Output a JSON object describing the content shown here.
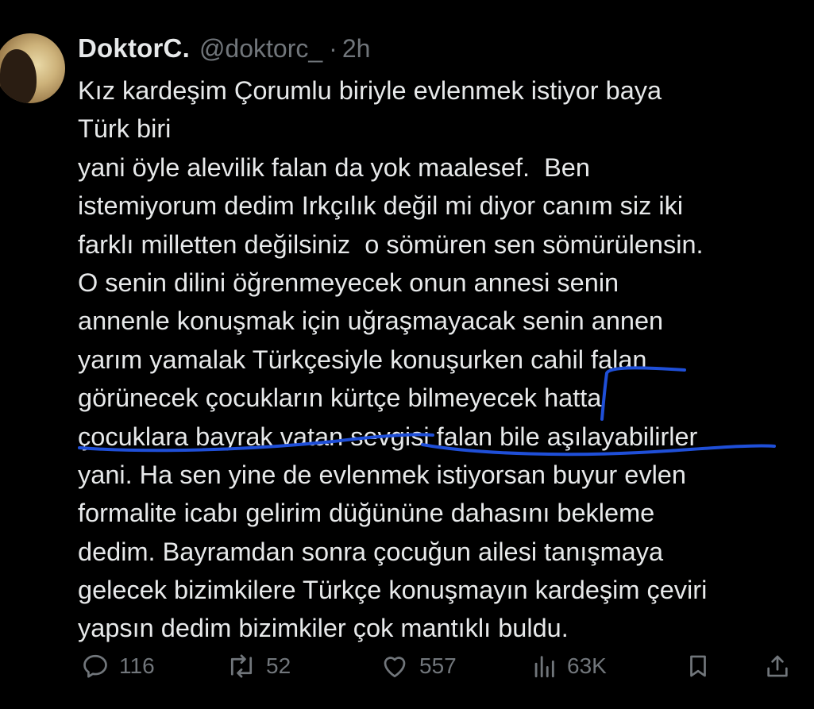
{
  "tweet": {
    "author": {
      "display_name": "DoktorC.",
      "handle": "@doktorc_",
      "separator": "·",
      "time": "2h"
    },
    "text_lines": [
      "Kız kardeşim Çorumlu biriyle evlenmek istiyor baya",
      "Türk biri",
      "yani öyle alevilik falan da yok maalesef.  Ben",
      "istemiyorum dedim Irkçılık değil mi diyor canım siz iki",
      "farklı milletten değilsiniz  o sömüren sen sömürülensin.",
      "O senin dilini öğrenmeyecek onun annesi senin",
      "annenle konuşmak için uğraşmayacak senin annen",
      "yarım yamalak Türkçesiyle konuşurken cahil falan",
      "görünecek çocukların kürtçe bilmeyecek hatta",
      "çocuklara bayrak vatan sevgisi falan bile aşılayabilirler",
      "yani. Ha sen yine de evlenmek istiyorsan buyur evlen",
      "formalite icabı gelirim düğününe dahasını bekleme",
      "dedim. Bayramdan sonra çocuğun ailesi tanışmaya",
      "gelecek bizimkilere Türkçe konuşmayın kardeşim çeviri",
      "yapsın dedim bizimkiler çok mantıklı buldu."
    ],
    "actions": {
      "replies": "116",
      "retweets": "52",
      "likes": "557",
      "views": "63K"
    },
    "icons": {
      "reply": "reply-icon",
      "retweet": "retweet-icon",
      "like": "heart-icon",
      "views": "views-chart-icon",
      "bookmark": "bookmark-icon",
      "share": "share-icon"
    },
    "colors": {
      "background": "#000000",
      "text": "#e7e9ea",
      "muted": "#71767b",
      "annotation": "#1f4fd8"
    }
  }
}
